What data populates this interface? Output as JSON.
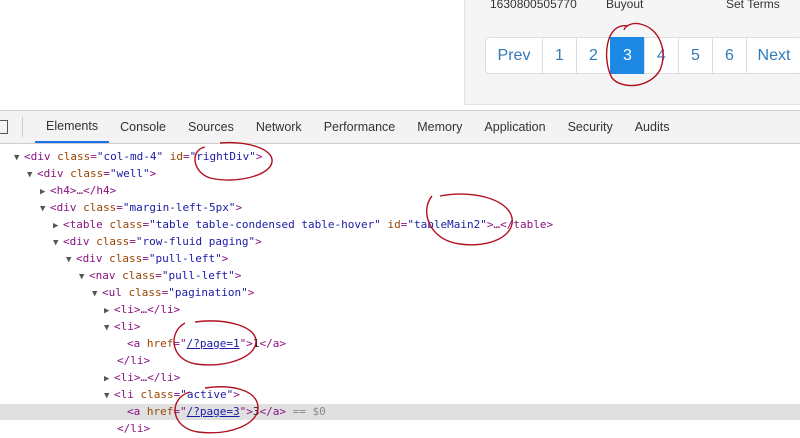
{
  "table_row": {
    "id_value": "1630800505770",
    "type_value": "Buyout",
    "action_value": "Set Terms"
  },
  "pagination": {
    "prev_label": "Prev",
    "pages": [
      "1",
      "2",
      "3",
      "4",
      "5",
      "6"
    ],
    "next_label": "Next",
    "active_page": "3"
  },
  "devtools": {
    "tabs": [
      "Elements",
      "Console",
      "Sources",
      "Network",
      "Performance",
      "Memory",
      "Application",
      "Security",
      "Audits"
    ],
    "active_tab": "Elements",
    "tree": {
      "l0_tag": "<div ",
      "l0_attr1": "class",
      "l0_val1": "\"col-md-4\"",
      "l0_attr2": "id",
      "l0_val2": "\"rightDiv\"",
      "l0_end": ">",
      "l1": "<div class=\"well\">",
      "l1_attr": "class",
      "l1_val": "\"well\"",
      "l2": "<h4>…</h4>",
      "l3_attr": "class",
      "l3_val": "\"margin-left-5px\"",
      "l4_attr1": "class",
      "l4_val1": "\"table table-condensed table-hover\"",
      "l4_attr2": "id",
      "l4_val2": "\"tableMain2\"",
      "l4_end": ">…</table>",
      "l5_attr": "class",
      "l5_val": "\"row-fluid paging\"",
      "l6_attr": "class",
      "l6_val": "\"pull-left\"",
      "l7_attr": "class",
      "l7_val": "\"pull-left\"",
      "l8_attr": "class",
      "l8_val": "\"pagination\"",
      "l9": "<li>…</li>",
      "l10": "<li>",
      "l11_attr": "href",
      "l11_link": "/?page=1",
      "l11_text": "1",
      "l12": "</li>",
      "l13": "<li>…</li>",
      "l14_attr": "class",
      "l14_val": "\"active\"",
      "l15_attr": "href",
      "l15_link": "/?page=3",
      "l15_text": "3",
      "l15_suffix": "== $0",
      "l16": "</li>"
    }
  }
}
